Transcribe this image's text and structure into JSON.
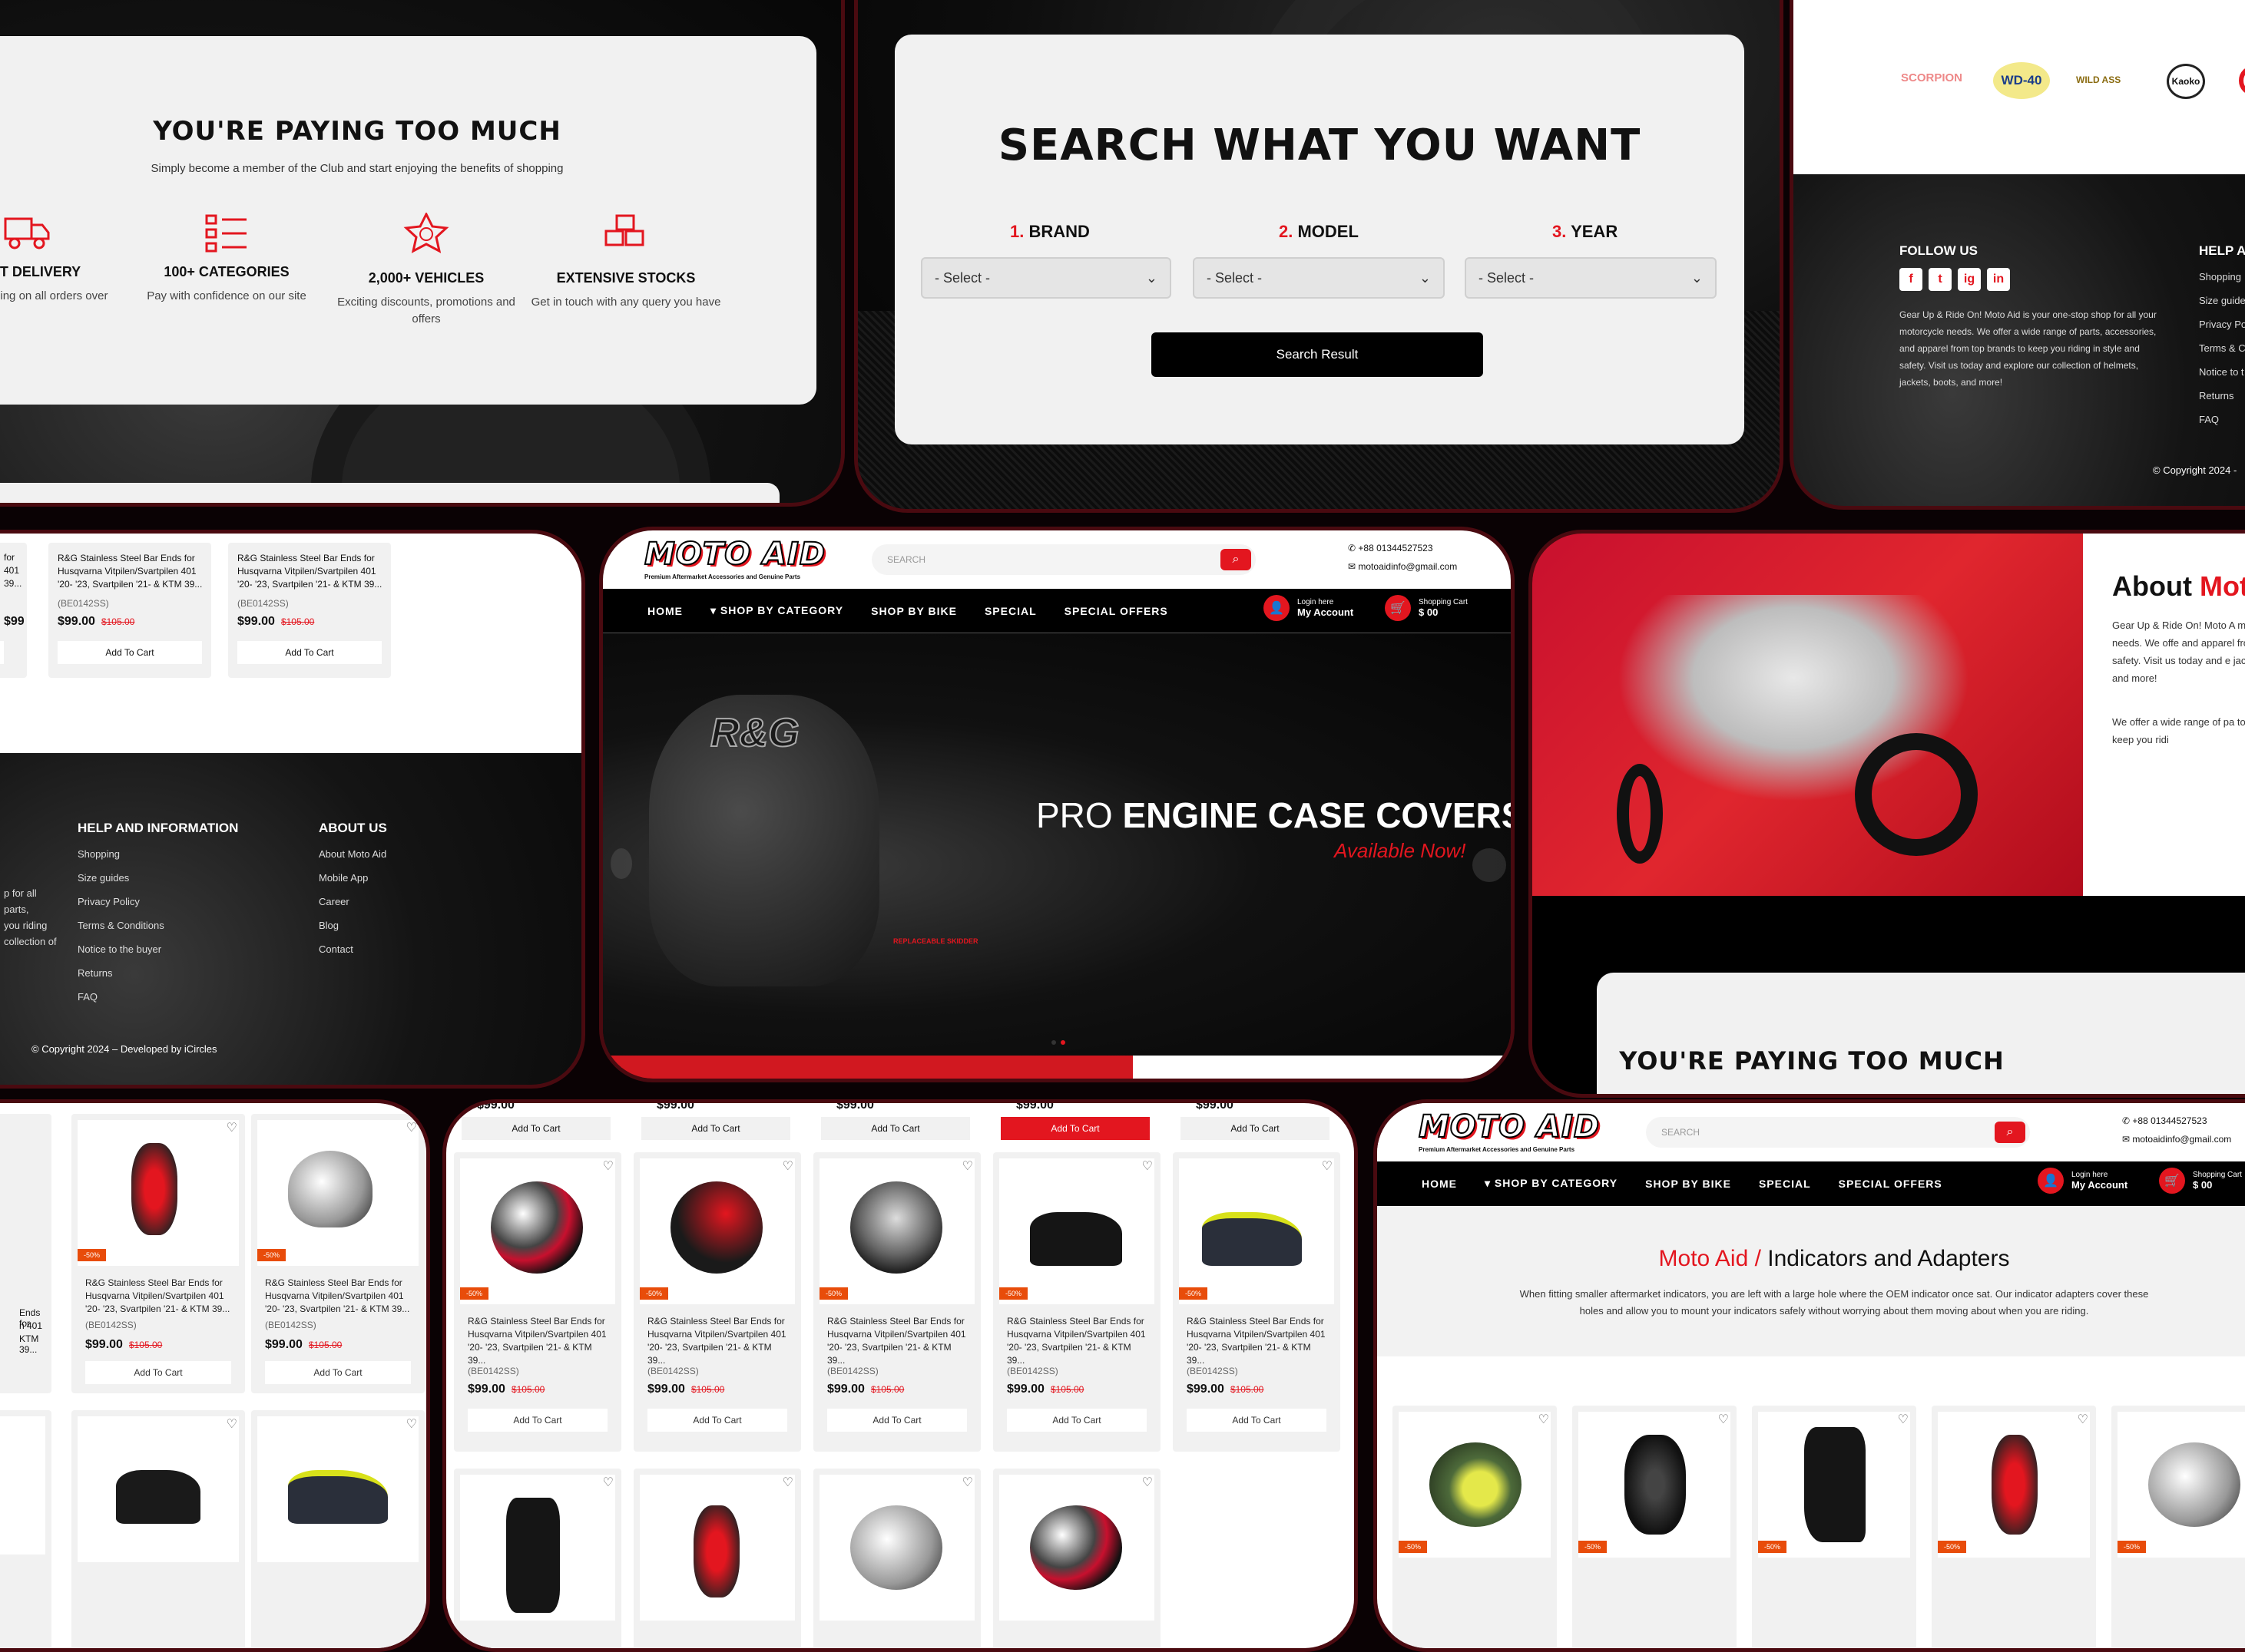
{
  "paying": {
    "title": "YOU'RE PAYING TOO MUCH",
    "subtitle": "Simply become a member of the Club and start enjoying the benefits of shopping",
    "features": [
      {
        "icon": "truck-icon",
        "title": "FAST DELIVERY",
        "desc": "Free shipping on all orders over"
      },
      {
        "icon": "list-icon",
        "title": "100+ CATEGORIES",
        "desc": "Pay with confidence on our site"
      },
      {
        "icon": "star-badge-icon",
        "title": "2,000+ VEHICLES",
        "desc": "Exciting discounts, promotions and offers"
      },
      {
        "icon": "boxes-icon",
        "title": "EXTENSIVE STOCKS",
        "desc": "Get in touch with any query you have"
      }
    ]
  },
  "search_panel": {
    "title": "SEARCH WHAT YOU WANT",
    "fields": [
      {
        "num": "1.",
        "label": "BRAND",
        "placeholder": "- Select -"
      },
      {
        "num": "2.",
        "label": "MODEL",
        "placeholder": "- Select -"
      },
      {
        "num": "3.",
        "label": "YEAR",
        "placeholder": "- Select -"
      }
    ],
    "button": "Search Result"
  },
  "brands_footer": {
    "brands": [
      "SCORPION",
      "WD-40",
      "WILD ASS",
      "Kaoko"
    ],
    "follow_title": "FOLLOW US",
    "social": [
      "f",
      "t",
      "ig",
      "in"
    ],
    "about_text": "Gear Up & Ride On! Moto Aid is your one-stop shop for all your motorcycle needs. We offer a wide range of parts, accessories, and apparel from top brands to keep you riding in style and safety. Visit us today and explore our collection of helmets, jackets, boots, and more!",
    "help_title": "HELP A",
    "help_links": [
      "Shopping",
      "Size guide",
      "Privacy Po",
      "Terms & C",
      "Notice to t",
      "Returns",
      "FAQ"
    ],
    "copyright": "© Copyright 2024 -"
  },
  "footer_panel": {
    "top_cards": [
      {
        "name": "R&G Stainless Steel Bar Ends for Husqvarna Vitpilen/Svartpilen 401 '20- '23, Svartpilen '21- & KTM 39...",
        "sku": "(BE0142SS)",
        "price": "$99.00",
        "old": "$105.00",
        "cta": "Add To Cart"
      },
      {
        "name": "R&G Stainless Steel Bar Ends for Husqvarna Vitpilen/Svartpilen 401 '20- '23, Svartpilen '21- & KTM 39...",
        "sku": "(BE0142SS)",
        "price": "$99.00",
        "old": "$105.00",
        "cta": "Add To Cart"
      }
    ],
    "partial_left": [
      "for",
      "401",
      "39..."
    ],
    "partial_price": "$99.00",
    "help_title": "HELP AND INFORMATION",
    "help_links": [
      "Shopping",
      "Size guides",
      "Privacy Policy",
      "Terms & Conditions",
      "Notice to the buyer",
      "Returns",
      "FAQ"
    ],
    "about_title": "ABOUT US",
    "about_links": [
      "About Moto Aid",
      "Mobile App",
      "Career",
      "Blog",
      "Contact"
    ],
    "left_text": [
      "p for all",
      "parts,",
      "you riding",
      "collection of"
    ],
    "copyright": "© Copyright 2024 – Developed by iCircles"
  },
  "header": {
    "logo": "MOTO AID",
    "tagline": "Premium Aftermarket Accessories and Genuine Parts",
    "search_placeholder": "SEARCH",
    "phone": "+88 01344527523",
    "email": "motoaidinfo@gmail.com",
    "nav": [
      "HOME",
      "SHOP BY CATEGORY",
      "SHOP BY BIKE",
      "SPECIAL",
      "SPECIAL OFFERS"
    ],
    "login_small": "Login here",
    "login_big": "My Account",
    "cart_small": "Shopping Cart",
    "cart_big": "$ 00"
  },
  "hero": {
    "brand_mark": "R&G",
    "line1_light": "PRO",
    "line1_bold": "ENGINE CASE COVERS",
    "line2": "Available Now!",
    "callout": "REPLACEABLE SKIDDER"
  },
  "about": {
    "title_plain": "About",
    "title_red": "Mot",
    "p1": "Gear Up & Ride On! Moto A motorcycle needs. We offe and apparel from top brand safety. Visit us today and e jackets, boots, and more!",
    "p2": "We offer a wide range of pa top brands to keep you ridi",
    "bottom_title": "YOU'RE PAYING TOO MUCH"
  },
  "grid_left": {
    "cards": [
      {
        "badge": "-50%",
        "name": "R&G Stainless Steel Bar Ends for Husqvarna Vitpilen/Svartpilen 401 '20- '23, Svartpilen '21- & KTM 39...",
        "sku": "(BE0142SS)",
        "price": "$99.00",
        "old": "$105.00",
        "cta": "Add To Cart"
      },
      {
        "badge": "-50%",
        "name": "R&G Stainless Steel Bar Ends for Husqvarna Vitpilen/Svartpilen 401 '20- '23, Svartpilen '21- & KTM 39...",
        "sku": "(BE0142SS)",
        "price": "$99.00",
        "old": "$105.00",
        "cta": "Add To Cart"
      }
    ],
    "partial_left": [
      "Ends for",
      "n 401",
      "KTM 39..."
    ]
  },
  "grid_mid": {
    "top_ctas": [
      "Add To Cart",
      "Add To Cart",
      "Add To Cart",
      "Add To Cart",
      "Add To Cart"
    ],
    "top_prices": [
      "$99.00",
      "$99.00",
      "$99.00",
      "$99.00",
      "$99.00"
    ],
    "cards": [
      {
        "badge": "-50%",
        "name": "R&G Stainless Steel Bar Ends for Husqvarna Vitpilen/Svartpilen 401 '20- '23, Svartpilen '21- & KTM 39...",
        "sku": "(BE0142SS)",
        "price": "$99.00",
        "old": "$105.00",
        "cta": "Add To Cart"
      },
      {
        "badge": "-50%",
        "name": "R&G Stainless Steel Bar Ends for Husqvarna Vitpilen/Svartpilen 401 '20- '23, Svartpilen '21- & KTM 39...",
        "sku": "(BE0142SS)",
        "price": "$99.00",
        "old": "$105.00",
        "cta": "Add To Cart"
      },
      {
        "badge": "-50%",
        "name": "R&G Stainless Steel Bar Ends for Husqvarna Vitpilen/Svartpilen 401 '20- '23, Svartpilen '21- & KTM 39...",
        "sku": "(BE0142SS)",
        "price": "$99.00",
        "old": "$105.00",
        "cta": "Add To Cart"
      },
      {
        "badge": "-50%",
        "name": "R&G Stainless Steel Bar Ends for Husqvarna Vitpilen/Svartpilen 401 '20- '23, Svartpilen '21- & KTM 39...",
        "sku": "(BE0142SS)",
        "price": "$99.00",
        "old": "$105.00",
        "cta": "Add To Cart"
      },
      {
        "badge": "-50%",
        "name": "R&G Stainless Steel Bar Ends for Husqvarna Vitpilen/Svartpilen 401 '20- '23, Svartpilen '21- & KTM 39...",
        "sku": "(BE0142SS)",
        "price": "$99.00",
        "old": "$105.00",
        "cta": "Add To Cart"
      }
    ]
  },
  "category": {
    "title_red": "Moto Aid /",
    "title_dark": "Indicators and Adapters",
    "desc": "When fitting smaller aftermarket indicators, you are left with a large hole where the OEM indicator once sat. Our indicator adapters cover these holes and allow you to mount your indicators safely without worrying about them moving about when you are riding.",
    "badges": [
      "-50%",
      "-50%",
      "-50%",
      "-50%",
      "-50%"
    ]
  },
  "colors": {
    "accent": "#e3161f",
    "badge": "#e84c0a",
    "frame": "#4a0a10"
  }
}
